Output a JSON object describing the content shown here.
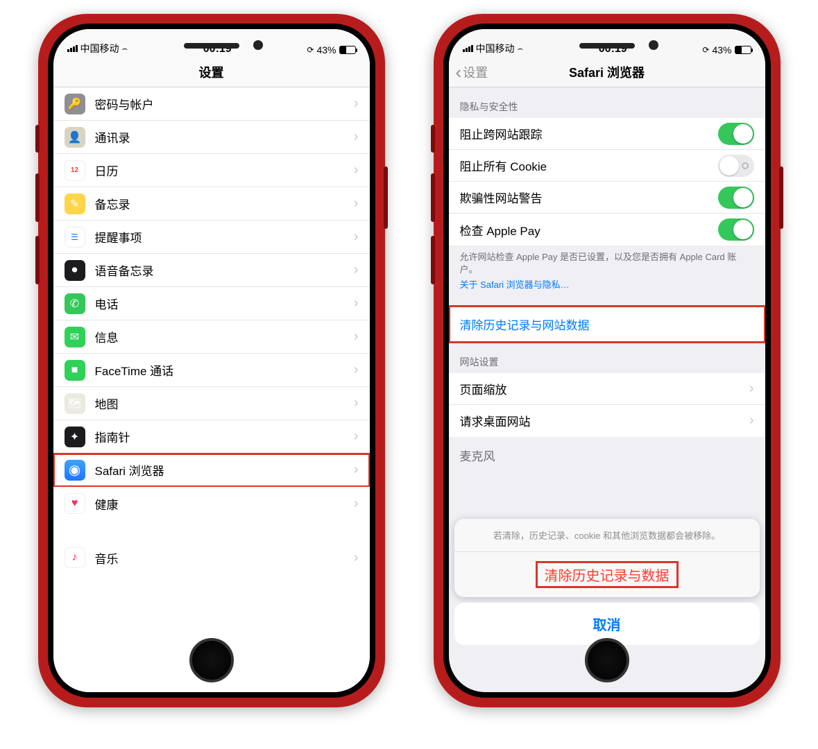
{
  "status": {
    "carrier": "中国移动",
    "time": "00:19",
    "battery_pct": "43%"
  },
  "left": {
    "title": "设置",
    "items": [
      {
        "label": "密码与帐户",
        "icon": "ic-key",
        "glyph": "🔑"
      },
      {
        "label": "通讯录",
        "icon": "ic-contacts",
        "glyph": "👤"
      },
      {
        "label": "日历",
        "icon": "ic-cal",
        "glyph": "12"
      },
      {
        "label": "备忘录",
        "icon": "ic-notes",
        "glyph": "✎"
      },
      {
        "label": "提醒事项",
        "icon": "ic-rem",
        "glyph": "☰"
      },
      {
        "label": "语音备忘录",
        "icon": "ic-voice",
        "glyph": "⏺"
      },
      {
        "label": "电话",
        "icon": "ic-phone",
        "glyph": "✆"
      },
      {
        "label": "信息",
        "icon": "ic-msg",
        "glyph": "✉"
      },
      {
        "label": "FaceTime 通话",
        "icon": "ic-ft",
        "glyph": "■"
      },
      {
        "label": "地图",
        "icon": "ic-maps",
        "glyph": "🗺"
      },
      {
        "label": "指南针",
        "icon": "ic-compass",
        "glyph": "✦"
      },
      {
        "label": "Safari 浏览器",
        "icon": "ic-safari",
        "glyph": "◉",
        "highlight": true
      },
      {
        "label": "健康",
        "icon": "ic-health",
        "glyph": "♥"
      }
    ],
    "group2": [
      {
        "label": "音乐",
        "icon": "ic-music",
        "glyph": "♪"
      }
    ]
  },
  "right": {
    "back": "设置",
    "title": "Safari 浏览器",
    "section_privacy": "隐私与安全性",
    "toggles": [
      {
        "label": "阻止跨网站跟踪",
        "on": true
      },
      {
        "label": "阻止所有 Cookie",
        "on": false
      },
      {
        "label": "欺骗性网站警告",
        "on": true
      },
      {
        "label": "检查 Apple Pay",
        "on": true
      }
    ],
    "note": "允许网站检查 Apple Pay 是否已设置，以及您是否拥有 Apple Card 账户。",
    "note_link": "关于 Safari 浏览器与隐私…",
    "clear_row": "清除历史记录与网站数据",
    "section_site": "网站设置",
    "site_rows": [
      {
        "label": "页面缩放"
      },
      {
        "label": "请求桌面网站"
      }
    ],
    "peek_row": "麦克风",
    "sheet_msg": "若清除，历史记录、cookie 和其他浏览数据都会被移除。",
    "sheet_action": "清除历史记录与数据",
    "sheet_cancel": "取消"
  }
}
